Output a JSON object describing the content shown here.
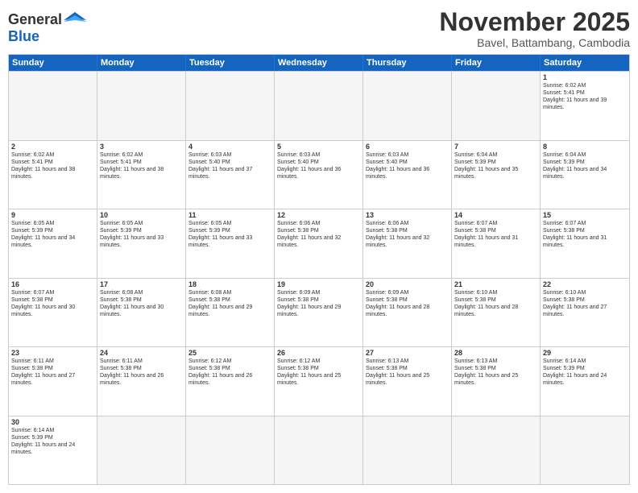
{
  "header": {
    "logo": {
      "general": "General",
      "blue": "Blue"
    },
    "title": "November 2025",
    "location": "Bavel, Battambang, Cambodia"
  },
  "days": [
    "Sunday",
    "Monday",
    "Tuesday",
    "Wednesday",
    "Thursday",
    "Friday",
    "Saturday"
  ],
  "weeks": [
    [
      {
        "day": "",
        "empty": true
      },
      {
        "day": "",
        "empty": true
      },
      {
        "day": "",
        "empty": true
      },
      {
        "day": "",
        "empty": true
      },
      {
        "day": "",
        "empty": true
      },
      {
        "day": "",
        "empty": true
      },
      {
        "day": "1",
        "sunrise": "Sunrise: 6:02 AM",
        "sunset": "Sunset: 5:41 PM",
        "daylight": "Daylight: 11 hours and 39 minutes."
      }
    ],
    [
      {
        "day": "2",
        "sunrise": "Sunrise: 6:02 AM",
        "sunset": "Sunset: 5:41 PM",
        "daylight": "Daylight: 11 hours and 38 minutes."
      },
      {
        "day": "3",
        "sunrise": "Sunrise: 6:02 AM",
        "sunset": "Sunset: 5:41 PM",
        "daylight": "Daylight: 11 hours and 38 minutes."
      },
      {
        "day": "4",
        "sunrise": "Sunrise: 6:03 AM",
        "sunset": "Sunset: 5:40 PM",
        "daylight": "Daylight: 11 hours and 37 minutes."
      },
      {
        "day": "5",
        "sunrise": "Sunrise: 6:03 AM",
        "sunset": "Sunset: 5:40 PM",
        "daylight": "Daylight: 11 hours and 36 minutes."
      },
      {
        "day": "6",
        "sunrise": "Sunrise: 6:03 AM",
        "sunset": "Sunset: 5:40 PM",
        "daylight": "Daylight: 11 hours and 36 minutes."
      },
      {
        "day": "7",
        "sunrise": "Sunrise: 6:04 AM",
        "sunset": "Sunset: 5:39 PM",
        "daylight": "Daylight: 11 hours and 35 minutes."
      },
      {
        "day": "8",
        "sunrise": "Sunrise: 6:04 AM",
        "sunset": "Sunset: 5:39 PM",
        "daylight": "Daylight: 11 hours and 34 minutes."
      }
    ],
    [
      {
        "day": "9",
        "sunrise": "Sunrise: 6:05 AM",
        "sunset": "Sunset: 5:39 PM",
        "daylight": "Daylight: 11 hours and 34 minutes."
      },
      {
        "day": "10",
        "sunrise": "Sunrise: 6:05 AM",
        "sunset": "Sunset: 5:39 PM",
        "daylight": "Daylight: 11 hours and 33 minutes."
      },
      {
        "day": "11",
        "sunrise": "Sunrise: 6:05 AM",
        "sunset": "Sunset: 5:39 PM",
        "daylight": "Daylight: 11 hours and 33 minutes."
      },
      {
        "day": "12",
        "sunrise": "Sunrise: 6:06 AM",
        "sunset": "Sunset: 5:38 PM",
        "daylight": "Daylight: 11 hours and 32 minutes."
      },
      {
        "day": "13",
        "sunrise": "Sunrise: 6:06 AM",
        "sunset": "Sunset: 5:38 PM",
        "daylight": "Daylight: 11 hours and 32 minutes."
      },
      {
        "day": "14",
        "sunrise": "Sunrise: 6:07 AM",
        "sunset": "Sunset: 5:38 PM",
        "daylight": "Daylight: 11 hours and 31 minutes."
      },
      {
        "day": "15",
        "sunrise": "Sunrise: 6:07 AM",
        "sunset": "Sunset: 5:38 PM",
        "daylight": "Daylight: 11 hours and 31 minutes."
      }
    ],
    [
      {
        "day": "16",
        "sunrise": "Sunrise: 6:07 AM",
        "sunset": "Sunset: 5:38 PM",
        "daylight": "Daylight: 11 hours and 30 minutes."
      },
      {
        "day": "17",
        "sunrise": "Sunrise: 6:08 AM",
        "sunset": "Sunset: 5:38 PM",
        "daylight": "Daylight: 11 hours and 30 minutes."
      },
      {
        "day": "18",
        "sunrise": "Sunrise: 6:08 AM",
        "sunset": "Sunset: 5:38 PM",
        "daylight": "Daylight: 11 hours and 29 minutes."
      },
      {
        "day": "19",
        "sunrise": "Sunrise: 6:09 AM",
        "sunset": "Sunset: 5:38 PM",
        "daylight": "Daylight: 11 hours and 29 minutes."
      },
      {
        "day": "20",
        "sunrise": "Sunrise: 6:09 AM",
        "sunset": "Sunset: 5:38 PM",
        "daylight": "Daylight: 11 hours and 28 minutes."
      },
      {
        "day": "21",
        "sunrise": "Sunrise: 6:10 AM",
        "sunset": "Sunset: 5:38 PM",
        "daylight": "Daylight: 11 hours and 28 minutes."
      },
      {
        "day": "22",
        "sunrise": "Sunrise: 6:10 AM",
        "sunset": "Sunset: 5:38 PM",
        "daylight": "Daylight: 11 hours and 27 minutes."
      }
    ],
    [
      {
        "day": "23",
        "sunrise": "Sunrise: 6:11 AM",
        "sunset": "Sunset: 5:38 PM",
        "daylight": "Daylight: 11 hours and 27 minutes."
      },
      {
        "day": "24",
        "sunrise": "Sunrise: 6:11 AM",
        "sunset": "Sunset: 5:38 PM",
        "daylight": "Daylight: 11 hours and 26 minutes."
      },
      {
        "day": "25",
        "sunrise": "Sunrise: 6:12 AM",
        "sunset": "Sunset: 5:38 PM",
        "daylight": "Daylight: 11 hours and 26 minutes."
      },
      {
        "day": "26",
        "sunrise": "Sunrise: 6:12 AM",
        "sunset": "Sunset: 5:38 PM",
        "daylight": "Daylight: 11 hours and 25 minutes."
      },
      {
        "day": "27",
        "sunrise": "Sunrise: 6:13 AM",
        "sunset": "Sunset: 5:38 PM",
        "daylight": "Daylight: 11 hours and 25 minutes."
      },
      {
        "day": "28",
        "sunrise": "Sunrise: 6:13 AM",
        "sunset": "Sunset: 5:38 PM",
        "daylight": "Daylight: 11 hours and 25 minutes."
      },
      {
        "day": "29",
        "sunrise": "Sunrise: 6:14 AM",
        "sunset": "Sunset: 5:39 PM",
        "daylight": "Daylight: 11 hours and 24 minutes."
      }
    ],
    [
      {
        "day": "30",
        "sunrise": "Sunrise: 6:14 AM",
        "sunset": "Sunset: 5:39 PM",
        "daylight": "Daylight: 11 hours and 24 minutes."
      },
      {
        "day": "",
        "empty": true
      },
      {
        "day": "",
        "empty": true
      },
      {
        "day": "",
        "empty": true
      },
      {
        "day": "",
        "empty": true
      },
      {
        "day": "",
        "empty": true
      },
      {
        "day": "",
        "empty": true
      }
    ]
  ]
}
